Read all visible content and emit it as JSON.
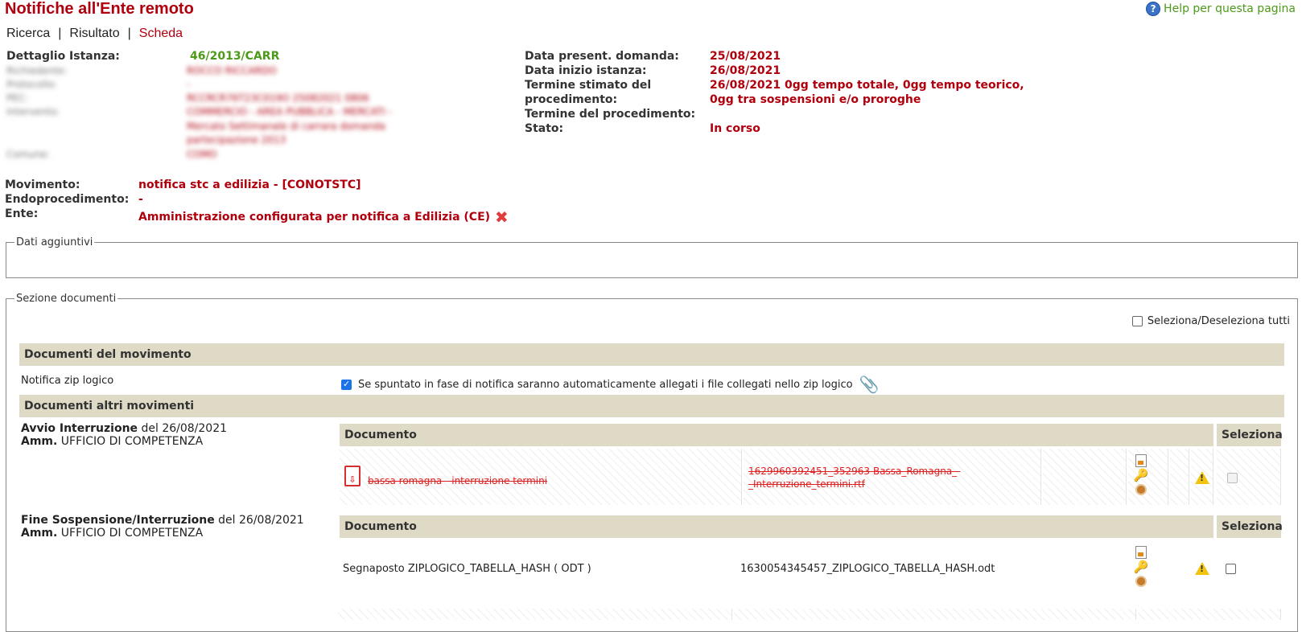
{
  "header": {
    "title": "Notifiche all'Ente remoto",
    "help_label": "Help per questa pagina"
  },
  "tabs": [
    {
      "label": "Ricerca"
    },
    {
      "label": "Risultato"
    },
    {
      "label": "Scheda"
    }
  ],
  "dettaglio": {
    "label_istanza": "Dettaglio Istanza:",
    "istanza": "46/2013/CARR",
    "label_richiedente": "Richiedente:",
    "richiedente": "ROCCO RICCARDO",
    "label_protocollo": "Protocollo:",
    "protocollo": "-",
    "label_pec": "PEC:",
    "pec": "RCCRCR76T23C019O 25082021 0806",
    "label_intervento": "Intervento:",
    "intervento_1": "COMMERCIO - AREA PUBBLICA - MERCATI -",
    "intervento_2": "Mercato Settimanale di carrara domanda",
    "intervento_3": "partecipazione 2013",
    "label_comune": "Comune:",
    "comune": "COMO"
  },
  "date": {
    "label_presentazione": "Data present. domanda:",
    "presentazione": "25/08/2021",
    "label_inizio": "Data inizio istanza:",
    "inizio": "26/08/2021",
    "label_termine_stimato_1": "Termine stimato del",
    "label_termine_stimato_2": "procedimento:",
    "termine_stimato_1": "26/08/2021  0gg tempo totale, 0gg tempo teorico,",
    "termine_stimato_2": "0gg tra sospensioni e/o proroghe",
    "label_termine": "Termine del procedimento:",
    "label_stato": "Stato:",
    "stato": "In corso"
  },
  "movimento": {
    "label_movimento": "Movimento:",
    "movimento": "notifica stc a edilizia - [CONOTSTC]",
    "label_endo": "Endoprocedimento:",
    "endo": "-",
    "label_ente": "Ente:",
    "ente": "Amministrazione configurata per notifica a Edilizia (CE)"
  },
  "dati_aggiuntivi": {
    "legend": "Dati aggiuntivi"
  },
  "documenti": {
    "legend": "Sezione documenti",
    "select_all_label": "Seleziona/Deseleziona tutti",
    "section_movimento": "Documenti del movimento",
    "notifica_label": "Notifica zip logico",
    "notifica_checked": true,
    "notifica_text": "Se spuntato in fase di notifica saranno automaticamente allegati i file collegati nello zip logico",
    "section_altri": "Documenti altri movimenti",
    "col_documento": "Documento",
    "col_seleziona": "Seleziona",
    "groups": [
      {
        "title": "Avvio Interruzione",
        "del": "del 26/08/2021",
        "amm_label": "Amm.",
        "amm": "UFFICIO DI COMPETENZA",
        "doc_name": "bassa romagna - interruzione termini",
        "file_1": "1629960392451_352963-Bassa_Romagna_-",
        "file_2": "_Interruzione_termini.rtf"
      },
      {
        "title": "Fine Sospensione/Interruzione",
        "del": "del 26/08/2021",
        "amm_label": "Amm.",
        "amm": "UFFICIO DI COMPETENZA",
        "doc_name": "Segnaposto ZIPLOGICO_TABELLA_HASH ( ODT )",
        "file_1": "1630054345457_ZIPLOGICO_TABELLA_HASH.odt"
      }
    ]
  }
}
